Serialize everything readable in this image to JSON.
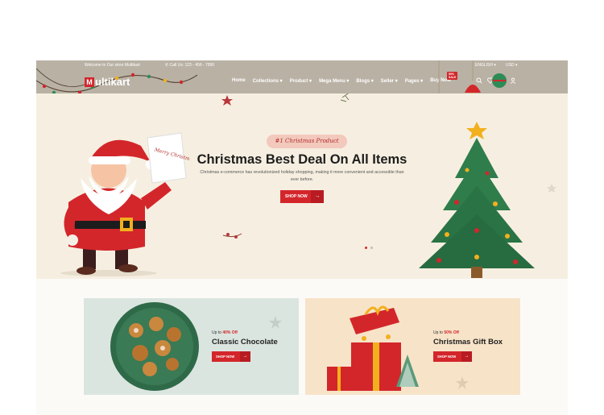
{
  "topbar": {
    "welcome": "Welcome to Our store Multikart",
    "call": "Call Us: 123 - 456 - 7890",
    "language": "ENGLISH",
    "currency": "USD"
  },
  "header": {
    "logo_mark": "M",
    "logo_text": "ultikart",
    "nav": [
      "Home",
      "Collections",
      "Product",
      "Mega Menu",
      "Blogs",
      "Seller",
      "Pages",
      "Buy Now"
    ],
    "buy_badge": "50% SALE"
  },
  "hero": {
    "tag": "#1 Christmas Product",
    "title": "Christmas Best Deal On All Items",
    "subtitle": "Christmas e-commerce has revolutionized holiday shopping, making it more convenient and accessible than ever before.",
    "button": "SHOP NOW",
    "scroll_text": "Merry Christmas"
  },
  "cards": [
    {
      "prefix": "Up to ",
      "discount": "40% Off",
      "title": "Classic Chocolate",
      "button": "SHOP NOW"
    },
    {
      "prefix": "Up to ",
      "discount": "50% Off",
      "title": "Christmas Gift Box",
      "button": "SHOP NOW"
    }
  ],
  "colors": {
    "accent": "#d3262b",
    "header": "#b9b1a4",
    "hero": "#f6efe1"
  },
  "icons": [
    "search-icon",
    "heart-icon",
    "cart-icon",
    "user-icon",
    "phone-icon",
    "arrow-right-icon"
  ]
}
